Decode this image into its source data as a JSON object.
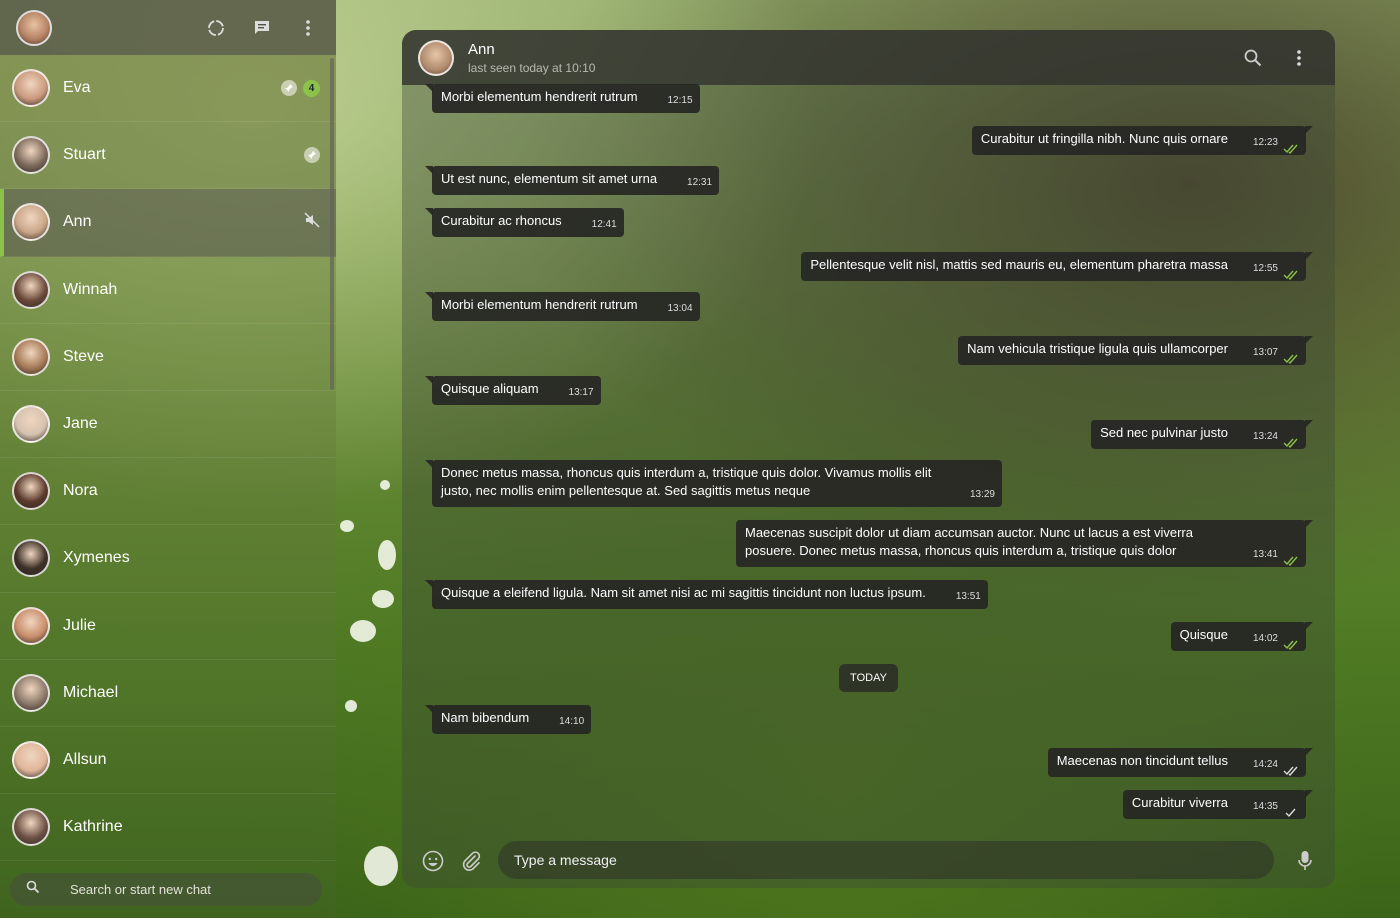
{
  "me": {
    "avatar_icon": "user-avatar"
  },
  "sidebar": {
    "header_icons": [
      "status-icon",
      "new-chat-icon",
      "menu-icon"
    ],
    "chats": [
      {
        "name": "Eva",
        "pinned": true,
        "unread": "4",
        "muted": false,
        "active": false,
        "avatar": "#c99a7e"
      },
      {
        "name": "Stuart",
        "pinned": true,
        "unread": "",
        "muted": false,
        "active": false,
        "avatar": "#7e6a5c"
      },
      {
        "name": "Ann",
        "pinned": false,
        "unread": "",
        "muted": true,
        "active": true,
        "avatar": "#caa688"
      },
      {
        "name": "Winnah",
        "pinned": false,
        "unread": "",
        "muted": false,
        "active": false,
        "avatar": "#6b4a3a"
      },
      {
        "name": "Steve",
        "pinned": false,
        "unread": "",
        "muted": false,
        "active": false,
        "avatar": "#a77b58"
      },
      {
        "name": "Jane",
        "pinned": false,
        "unread": "",
        "muted": false,
        "active": false,
        "avatar": "#d6c2b0"
      },
      {
        "name": "Nora",
        "pinned": false,
        "unread": "",
        "muted": false,
        "active": false,
        "avatar": "#5b3a2c"
      },
      {
        "name": "Xymenes",
        "pinned": false,
        "unread": "",
        "muted": false,
        "active": false,
        "avatar": "#3d3028"
      },
      {
        "name": "Julie",
        "pinned": false,
        "unread": "",
        "muted": false,
        "active": false,
        "avatar": "#c98e6c"
      },
      {
        "name": "Michael",
        "pinned": false,
        "unread": "",
        "muted": false,
        "active": false,
        "avatar": "#8d7a6b"
      },
      {
        "name": "Allsun",
        "pinned": false,
        "unread": "",
        "muted": false,
        "active": false,
        "avatar": "#e0b59a"
      },
      {
        "name": "Kathrine",
        "pinned": false,
        "unread": "",
        "muted": false,
        "active": false,
        "avatar": "#6e5246"
      }
    ],
    "search": {
      "placeholder": "Search or start new chat"
    }
  },
  "chat": {
    "contact_name": "Ann",
    "last_seen": "last seen today at 10:10",
    "header_icons": [
      "search-icon",
      "menu-icon"
    ],
    "messages": [
      {
        "dir": "in",
        "text": "Morbi elementum hendrerit rutrum",
        "time": "12:15"
      },
      {
        "dir": "out",
        "text": "Curabitur ut fringilla nibh. Nunc quis ornare",
        "time": "12:23",
        "status": "read"
      },
      {
        "dir": "in",
        "text": "Ut est nunc, elementum sit amet urna",
        "time": "12:31"
      },
      {
        "dir": "in",
        "text": "Curabitur ac rhoncus",
        "time": "12:41"
      },
      {
        "dir": "out",
        "text": "Pellentesque velit nisl, mattis sed mauris eu, elementum pharetra massa",
        "time": "12:55",
        "status": "read"
      },
      {
        "dir": "in",
        "text": "Morbi elementum hendrerit rutrum",
        "time": "13:04"
      },
      {
        "dir": "out",
        "text": "Nam vehicula tristique ligula quis ullamcorper",
        "time": "13:07",
        "status": "read"
      },
      {
        "dir": "in",
        "text": "Quisque aliquam",
        "time": "13:17"
      },
      {
        "dir": "out",
        "text": "Sed nec pulvinar justo",
        "time": "13:24",
        "status": "read"
      },
      {
        "dir": "in",
        "text": "Donec metus massa, rhoncus quis interdum a, tristique quis dolor. Vivamus mollis elit justo, nec mollis enim pellentesque at. Sed sagittis metus neque",
        "time": "13:29"
      },
      {
        "dir": "out",
        "text": "Maecenas suscipit dolor ut diam accumsan auctor. Nunc ut lacus a est viverra posuere. Donec metus massa, rhoncus quis interdum a, tristique quis dolor",
        "time": "13:41",
        "status": "read"
      },
      {
        "dir": "in",
        "text": "Quisque a eleifend ligula. Nam sit amet nisi ac mi sagittis tincidunt non luctus ipsum.",
        "time": "13:51"
      },
      {
        "dir": "out",
        "text": "Quisque",
        "time": "14:02",
        "status": "read"
      },
      {
        "dir": "in",
        "text": "Nam bibendum",
        "time": "14:10"
      },
      {
        "dir": "out",
        "text": "Maecenas non tincidunt tellus",
        "time": "14:24",
        "status": "delivered"
      },
      {
        "dir": "out",
        "text": "Curabitur viverra",
        "time": "14:35",
        "status": "sent"
      }
    ],
    "day_separator": "TODAY",
    "composer": {
      "placeholder": "Type a message"
    },
    "composer_icons": [
      "emoji-icon",
      "attach-icon",
      "microphone-icon"
    ]
  },
  "colors": {
    "accent": "#8bc34a",
    "read_tick": "#8bc34a",
    "bubble": "#262624"
  }
}
